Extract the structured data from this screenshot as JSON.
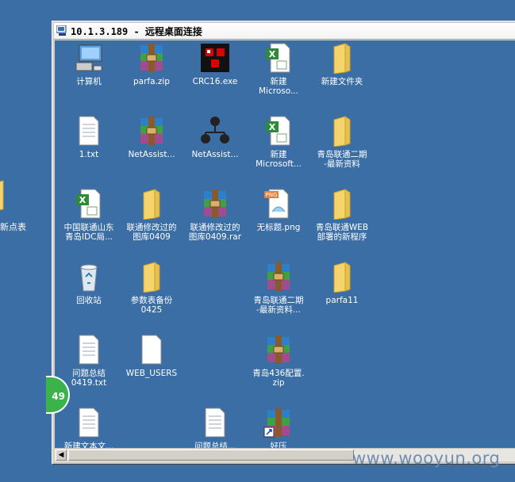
{
  "outer_desktop": {
    "folder_label": "新点表"
  },
  "window": {
    "title": "10.1.3.189 - 远程桌面连接"
  },
  "desktop_icons": [
    {
      "label": "计算机",
      "icon": "computer-icon"
    },
    {
      "label": "parfa.zip",
      "icon": "archive-icon"
    },
    {
      "label": "CRC16.exe",
      "icon": "exe-cubes-icon"
    },
    {
      "label": "新建\nMicroso...",
      "icon": "excel-icon"
    },
    {
      "label": "新建文件夹",
      "icon": "folder-icon"
    },
    {
      "label": "1.txt",
      "icon": "text-file-icon"
    },
    {
      "label": "NetAssist...",
      "icon": "archive-icon"
    },
    {
      "label": "NetAssist...",
      "icon": "network-icon"
    },
    {
      "label": "新建\nMicrosoft...",
      "icon": "excel-icon"
    },
    {
      "label": "青岛联通二期\n-最新资料",
      "icon": "folder-icon"
    },
    {
      "label": "中国联通山东\n青岛IDC局...",
      "icon": "excel-icon"
    },
    {
      "label": "联通修改过的\n图库0409",
      "icon": "folder-icon"
    },
    {
      "label": "联通修改过的\n图库0409.rar",
      "icon": "archive-icon"
    },
    {
      "label": "无标题.png",
      "icon": "png-file-icon"
    },
    {
      "label": "青岛联通WEB\n部署的新程序",
      "icon": "folder-icon"
    },
    {
      "label": "回收站",
      "icon": "recycle-bin-icon"
    },
    {
      "label": "参数表备份\n0425",
      "icon": "folder-icon"
    },
    {
      "label": "青岛联通二期\n-最新资料...",
      "icon": "archive-icon"
    },
    {
      "label": "parfa11",
      "icon": "folder-icon"
    },
    {
      "label": "问题总结\n0419.txt",
      "icon": "text-file-icon"
    },
    {
      "label": "WEB_USERS",
      "icon": "blank-file-icon"
    },
    {
      "label": "青岛436配置.\nzip",
      "icon": "archive-icon"
    },
    {
      "label": "新建文本文...",
      "icon": "text-file-icon"
    },
    {
      "label": "问题总结...",
      "icon": "text-file-icon"
    },
    {
      "label": "好压",
      "icon": "archive-shortcut-icon"
    }
  ],
  "badge": {
    "text": "49"
  },
  "watermark": "www.wooyun.org",
  "colors": {
    "desktop": "#3a6ea5",
    "folder": "#f5d56b",
    "badge": "#3cb34a"
  }
}
